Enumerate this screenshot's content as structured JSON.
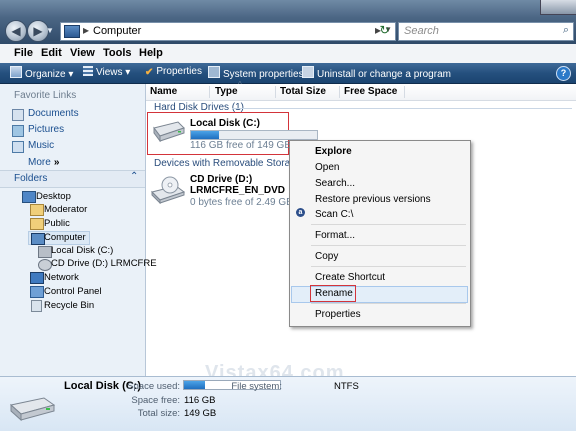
{
  "titlebar": {
    "address_text": "Computer",
    "search_placeholder": "Search"
  },
  "menubar": {
    "items": [
      "File",
      "Edit",
      "View",
      "Tools",
      "Help"
    ]
  },
  "commandbar": {
    "organize": "Organize",
    "views": "Views",
    "properties": "Properties",
    "system_properties": "System properties",
    "uninstall": "Uninstall or change a program"
  },
  "sidebar": {
    "favorite_title": "Favorite Links",
    "favorites": [
      "Documents",
      "Pictures",
      "Music"
    ],
    "more": "More",
    "folders_title": "Folders",
    "tree": [
      "Desktop",
      "Moderator",
      "Public",
      "Computer",
      "Local Disk (C:)",
      "CD Drive (D:) LRMCFRE",
      "Network",
      "Control Panel",
      "Recycle Bin"
    ]
  },
  "columns": [
    "Name",
    "Type",
    "Total Size",
    "Free Space"
  ],
  "groups": {
    "hdd": "Hard Disk Drives (1)",
    "removable": "Devices with Removable Storage (1)"
  },
  "drives": {
    "local_name": "Local Disk (C:)",
    "local_free": "116 GB free of 149 GB",
    "local_used_fraction": 0.22,
    "cd_name1": "CD Drive (D:)",
    "cd_name2": "LRMCFRE_EN_DVD",
    "cd_free": "0 bytes free of 2.49 GB"
  },
  "context_menu": [
    "Explore",
    "Open",
    "Search...",
    "Restore previous versions",
    "Scan C:\\",
    "Format...",
    "Copy",
    "Create Shortcut",
    "Rename",
    "Properties"
  ],
  "watermark": "Vistax64.com",
  "details": {
    "name": "Local Disk (C:)",
    "space_used_label": "Space used:",
    "space_used_fraction": 0.22,
    "filesystem_label": "File system:",
    "filesystem_value": "NTFS",
    "space_free_label": "Space free:",
    "space_free_value": "116 GB",
    "total_size_label": "Total size:",
    "total_size_value": "149 GB"
  }
}
